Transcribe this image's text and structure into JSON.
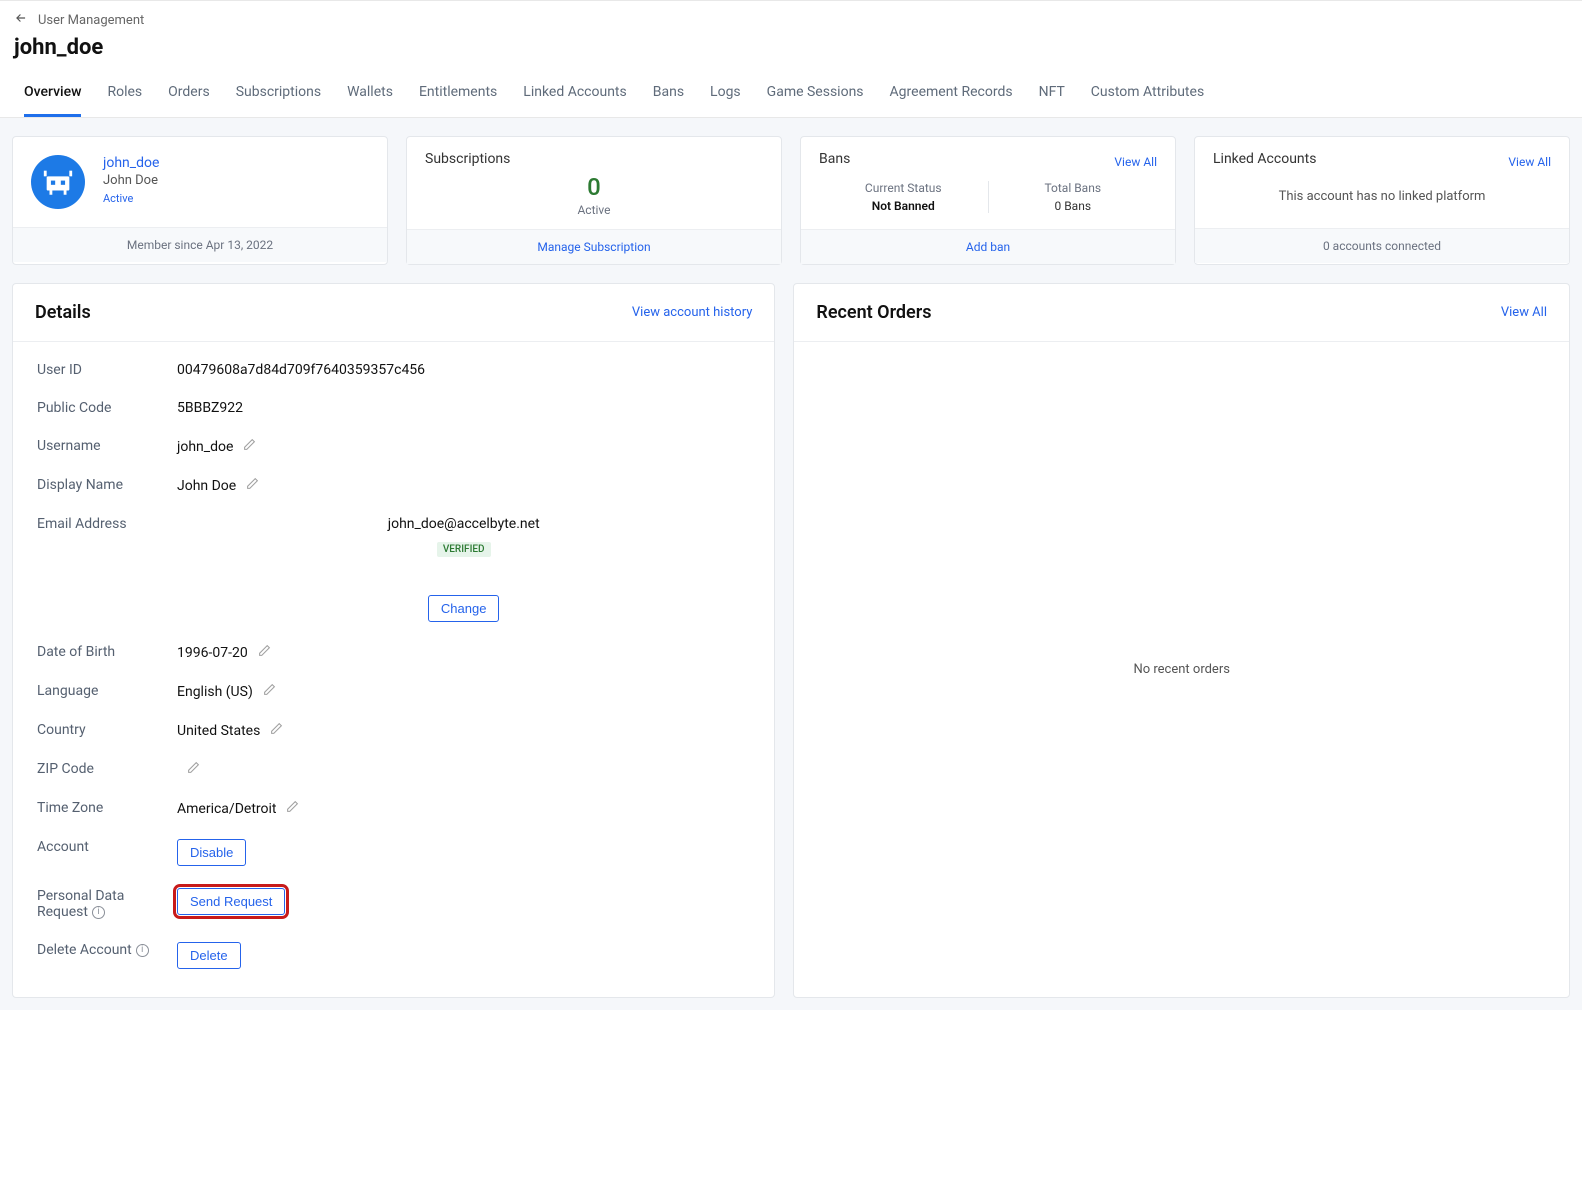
{
  "breadcrumb": {
    "parent": "User Management"
  },
  "page_title": "john_doe",
  "tabs": [
    "Overview",
    "Roles",
    "Orders",
    "Subscriptions",
    "Wallets",
    "Entitlements",
    "Linked Accounts",
    "Bans",
    "Logs",
    "Game Sessions",
    "Agreement Records",
    "NFT",
    "Custom Attributes"
  ],
  "active_tab_index": 0,
  "profile": {
    "username": "john_doe",
    "display_name": "John Doe",
    "status": "Active",
    "member_since": "Member since Apr 13, 2022"
  },
  "subscriptions": {
    "title": "Subscriptions",
    "count": "0",
    "status": "Active",
    "action": "Manage Subscription"
  },
  "bans": {
    "title": "Bans",
    "view_all": "View All",
    "current_status_label": "Current Status",
    "current_status_value": "Not Banned",
    "total_label": "Total Bans",
    "total_value": "0 Bans",
    "action": "Add ban"
  },
  "linked": {
    "title": "Linked Accounts",
    "view_all": "View All",
    "empty": "This account has no linked platform",
    "footer": "0 accounts connected"
  },
  "details": {
    "heading": "Details",
    "link": "View account history",
    "rows": {
      "user_id": {
        "label": "User ID",
        "value": "00479608a7d84d709f7640359357c456"
      },
      "public_code": {
        "label": "Public Code",
        "value": "5BBBZ922"
      },
      "username": {
        "label": "Username",
        "value": "john_doe"
      },
      "display_name": {
        "label": "Display Name",
        "value": "John Doe"
      },
      "email": {
        "label": "Email Address",
        "value": "john_doe@accelbyte.net",
        "verified": "VERIFIED",
        "change": "Change"
      },
      "dob": {
        "label": "Date of Birth",
        "value": "1996-07-20"
      },
      "language": {
        "label": "Language",
        "value": "English (US)"
      },
      "country": {
        "label": "Country",
        "value": "United States"
      },
      "zip": {
        "label": "ZIP Code",
        "value": ""
      },
      "timezone": {
        "label": "Time Zone",
        "value": "America/Detroit"
      },
      "account": {
        "label": "Account",
        "action": "Disable"
      },
      "pdr": {
        "label": "Personal Data Request",
        "action": "Send Request"
      },
      "delete": {
        "label": "Delete Account",
        "action": "Delete"
      }
    }
  },
  "orders": {
    "heading": "Recent Orders",
    "link": "View All",
    "empty": "No recent orders"
  }
}
